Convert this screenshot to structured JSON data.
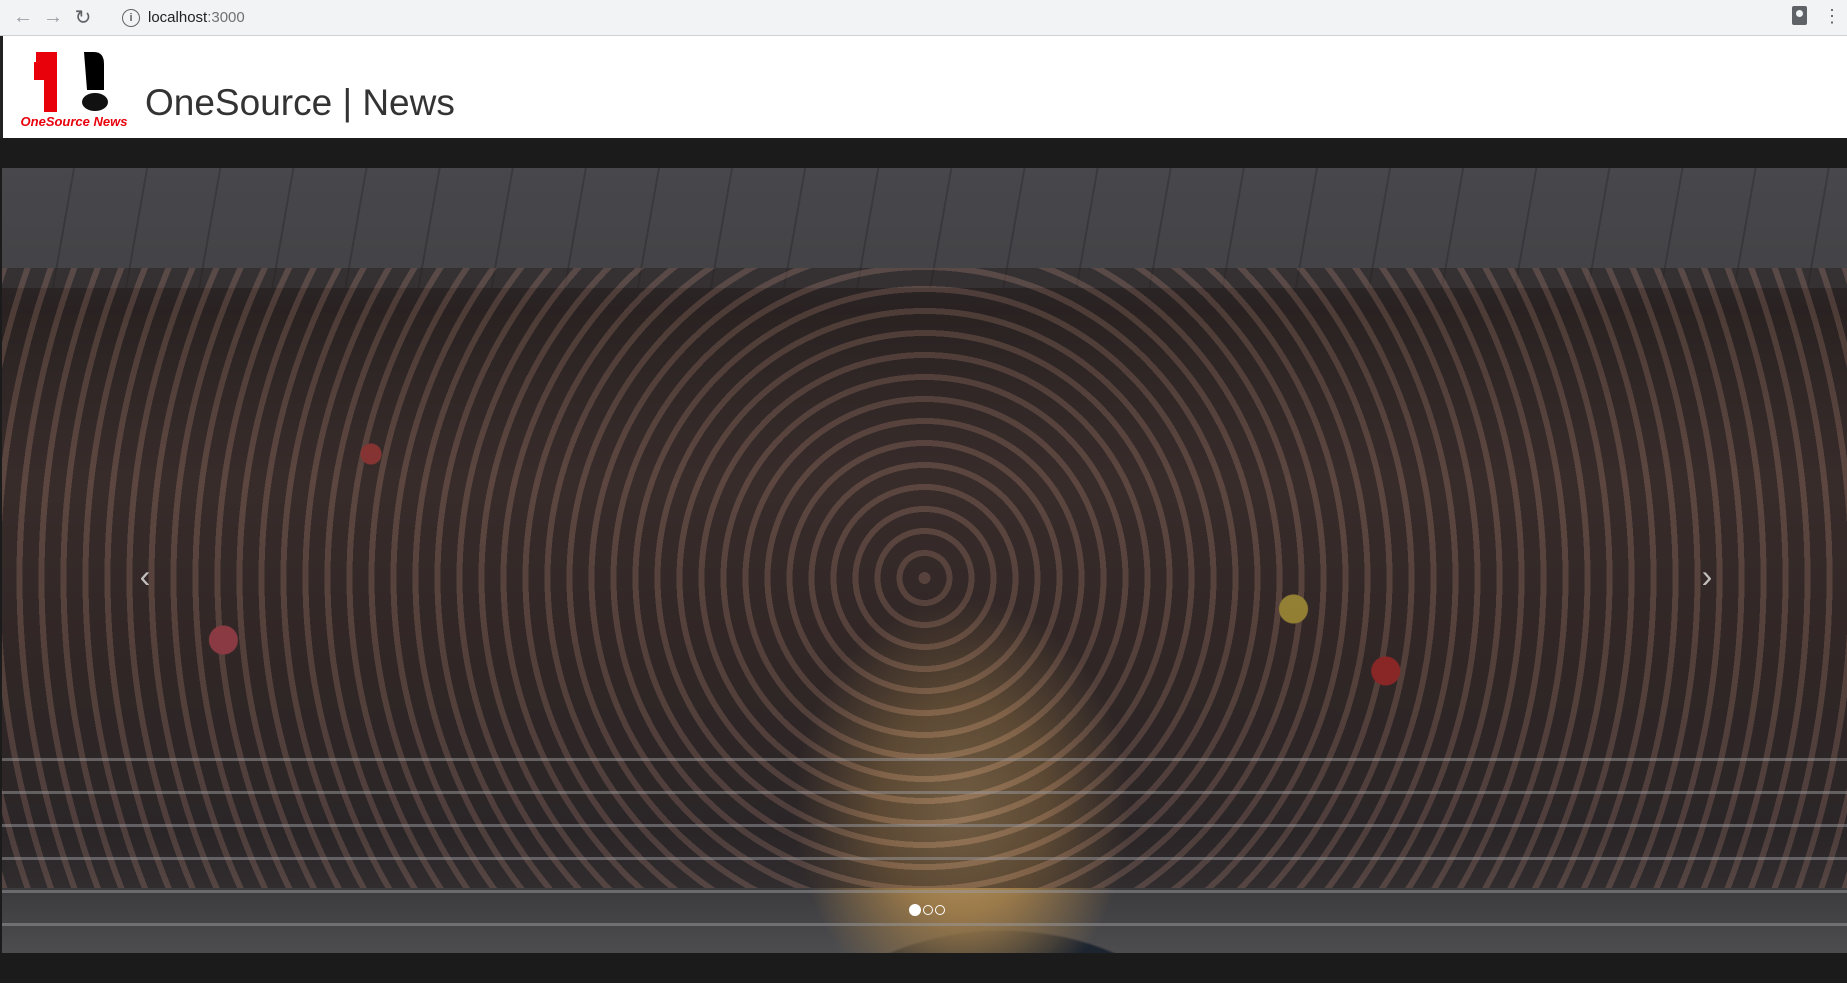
{
  "browser": {
    "url_host": "localhost",
    "url_port": ":3000"
  },
  "header": {
    "logo_text": "OneSource News",
    "title": "OneSource | News"
  },
  "carousel": {
    "slide_count": 3,
    "active_index": 0,
    "prev_label": "‹",
    "next_label": "›"
  },
  "colors": {
    "brand_red": "#e8000b",
    "band": "#1b1b1b"
  }
}
